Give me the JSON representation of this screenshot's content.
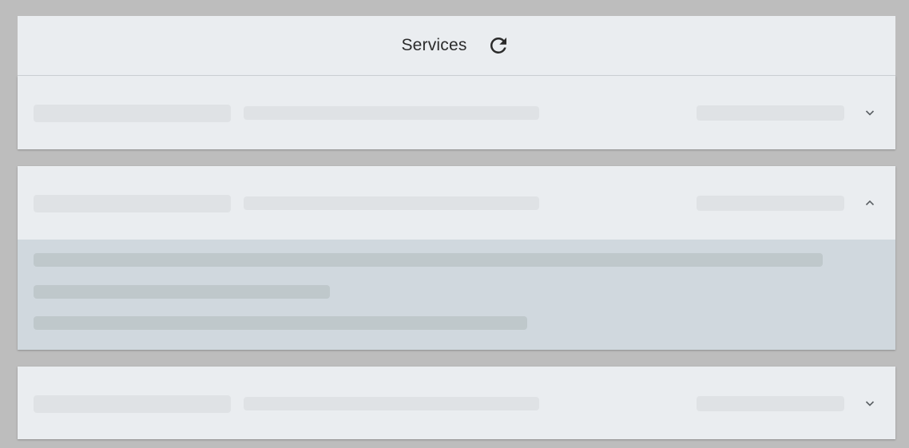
{
  "header": {
    "title": "Services",
    "refresh_icon": "refresh-icon"
  },
  "services": [
    {
      "state": "collapsed",
      "chevron": "chevron-down-icon"
    },
    {
      "state": "expanded",
      "chevron": "chevron-up-icon"
    },
    {
      "state": "collapsed",
      "chevron": "chevron-down-icon"
    }
  ],
  "colors": {
    "background": "#bdbdbd",
    "panel": "#eaedf0",
    "skeleton": "#dfe2e5",
    "expanded_body": "#d0d8de",
    "expanded_skeleton": "#bfc8cb",
    "text": "#2b2b2b"
  }
}
